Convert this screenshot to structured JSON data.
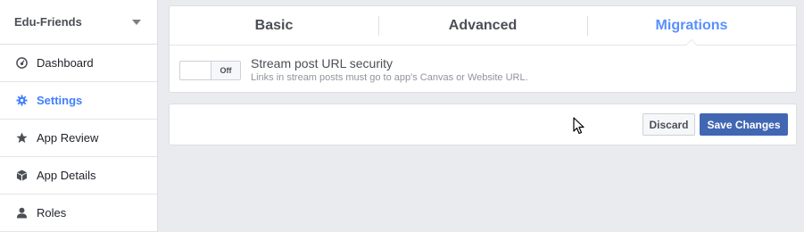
{
  "sidebar": {
    "app_name": "Edu-Friends",
    "items": [
      {
        "label": "Dashboard",
        "icon": "dashboard-icon"
      },
      {
        "label": "Settings",
        "icon": "gear-icon"
      },
      {
        "label": "App Review",
        "icon": "star-icon"
      },
      {
        "label": "App Details",
        "icon": "cube-icon"
      },
      {
        "label": "Roles",
        "icon": "person-icon"
      }
    ],
    "active_item": "Settings"
  },
  "tabs": [
    {
      "label": "Basic"
    },
    {
      "label": "Advanced"
    },
    {
      "label": "Migrations"
    }
  ],
  "active_tab": "Migrations",
  "setting": {
    "toggle_state": "Off",
    "title": "Stream post URL security",
    "description": "Links in stream posts must go to app's Canvas or Website URL."
  },
  "actions": {
    "discard_label": "Discard",
    "save_label": "Save Changes"
  },
  "colors": {
    "accent": "#5890ff",
    "primary_button": "#4267b2",
    "background": "#e9ebee"
  }
}
